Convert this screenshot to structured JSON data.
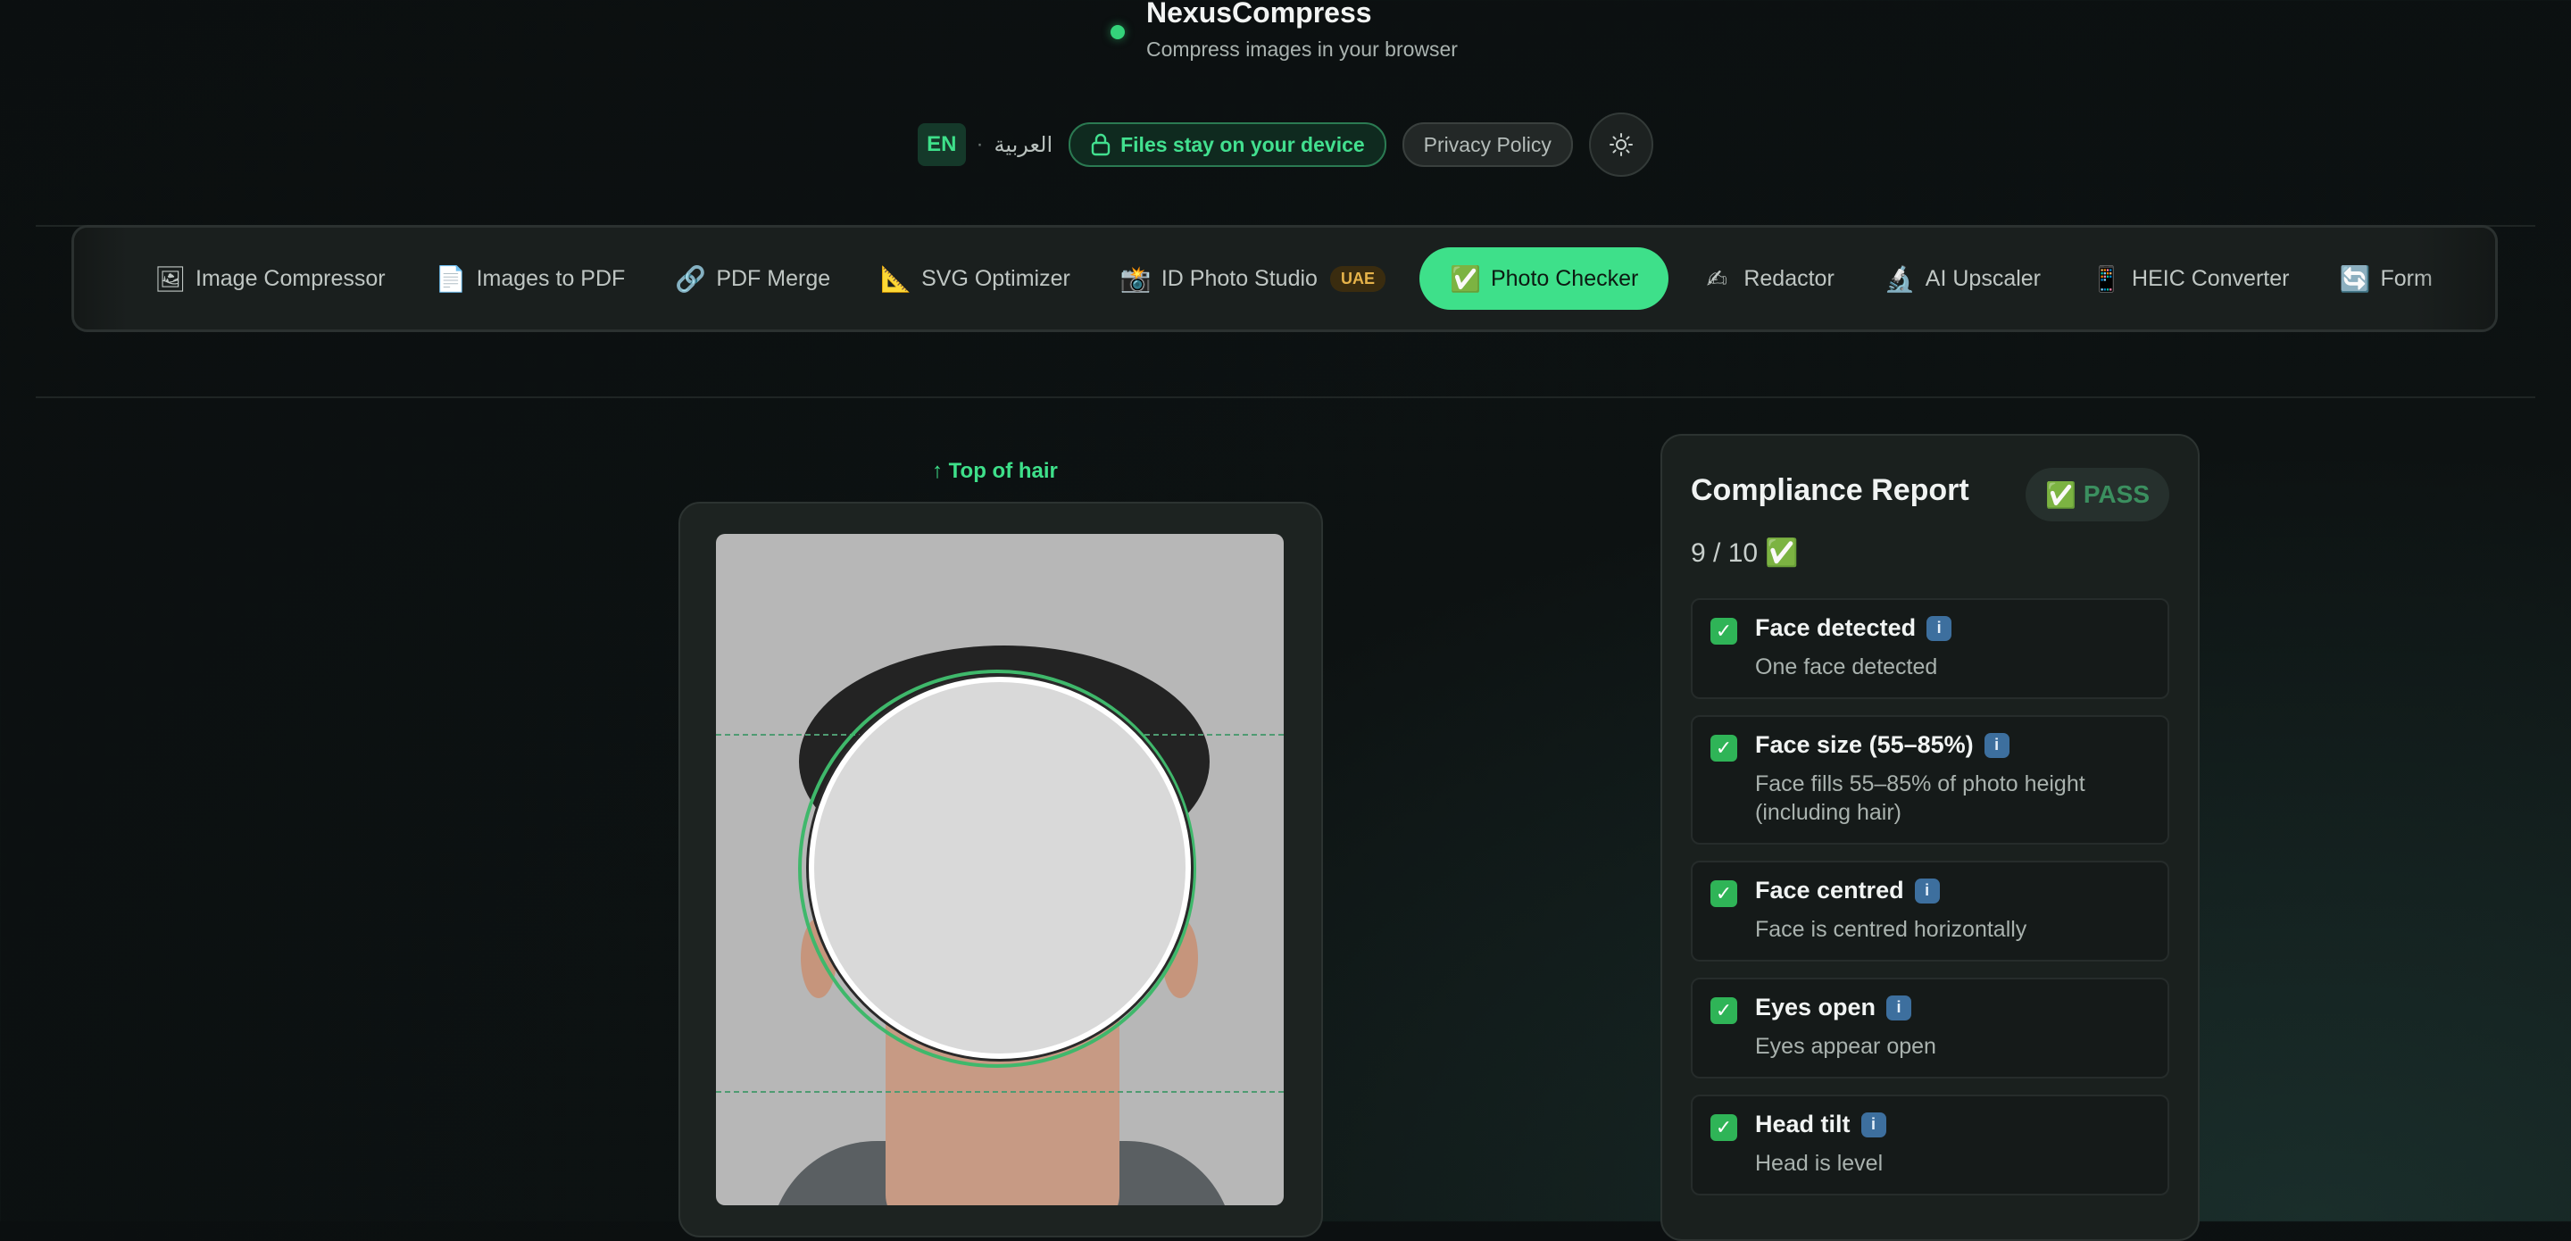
{
  "brand": {
    "title": "NexusCompress",
    "subtitle": "Compress images in your browser"
  },
  "header": {
    "lang_en": "EN",
    "lang_sep": "·",
    "lang_ar": "العربية",
    "device_pill": "Files stay on your device",
    "privacy": "Privacy Policy"
  },
  "nav": {
    "items": [
      {
        "icon": "🖼",
        "label": "Image Compressor"
      },
      {
        "icon": "📄",
        "label": "Images to PDF"
      },
      {
        "icon": "🔗",
        "label": "PDF Merge"
      },
      {
        "icon": "📐",
        "label": "SVG Optimizer"
      },
      {
        "icon": "📸",
        "label": "ID Photo Studio",
        "badge": "UAE"
      },
      {
        "icon": "✅",
        "label": "Photo Checker",
        "active": true
      },
      {
        "icon": "✍",
        "label": "Redactor"
      },
      {
        "icon": "🔬",
        "label": "AI Upscaler"
      },
      {
        "icon": "📱",
        "label": "HEIC Converter"
      },
      {
        "icon": "🔄",
        "label": "Form"
      }
    ]
  },
  "photo": {
    "top_label": "↑ Top of hair"
  },
  "report": {
    "title": "Compliance Report",
    "status_icon": "✅",
    "status": "PASS",
    "score": "9 / 10 ✅",
    "checks": [
      {
        "name": "Face detected",
        "desc": "One face detected"
      },
      {
        "name": "Face size (55–85%)",
        "desc": "Face fills 55–85% of photo height (including hair)"
      },
      {
        "name": "Face centred",
        "desc": "Face is centred horizontally"
      },
      {
        "name": "Eyes open",
        "desc": "Eyes appear open"
      },
      {
        "name": "Head tilt",
        "desc": "Head is level"
      }
    ],
    "check_icon": "✓",
    "info_icon": "i"
  }
}
